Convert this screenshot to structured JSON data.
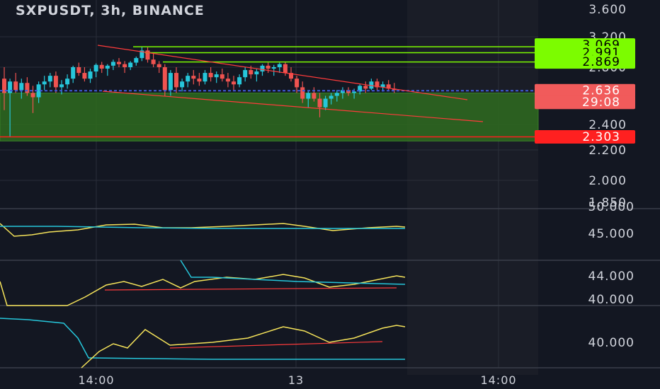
{
  "header": {
    "title": "SXPUSDT, 3h, BINANCE"
  },
  "colors": {
    "background": "#131722",
    "axis_background": "#131722",
    "price_text": "#d1d4dc",
    "bull": "#26c6da",
    "bear": "#ef5350",
    "resistance": "#7cfc00",
    "support_zone": "#2e6b1f",
    "support_line": "#ff1e1e",
    "trend": "#ff3b3b",
    "dotted_current": "#3f5bd8",
    "oscillator_a": "#f5e35a",
    "oscillator_b": "#26c6da"
  },
  "price_axis": {
    "ticks": [
      "3.600",
      "3.200",
      "2.800",
      "2.400",
      "2.200",
      "2.000",
      "1.850"
    ],
    "tick_values": [
      3.6,
      3.2,
      2.8,
      2.4,
      2.2,
      2.0,
      1.85
    ]
  },
  "price_labels": [
    {
      "text": "3.069",
      "value": 3.069,
      "kind": "resistance"
    },
    {
      "text": "2.991",
      "value": 2.991,
      "kind": "resistance"
    },
    {
      "text": "2.869",
      "value": 2.869,
      "kind": "resistance"
    },
    {
      "text": "2.636",
      "value": 2.636,
      "kind": "current"
    },
    {
      "text": "29:08",
      "value": 2.58,
      "kind": "countdown"
    },
    {
      "text": "2.303",
      "value": 2.303,
      "kind": "support"
    }
  ],
  "indicator_panes": [
    {
      "ticks": [
        "50.000",
        "45.000"
      ],
      "tick_values": [
        50,
        45
      ]
    },
    {
      "ticks": [
        "44.000",
        "40.000"
      ],
      "tick_values": [
        44,
        40
      ]
    },
    {
      "ticks": [
        "40.000"
      ],
      "tick_values": [
        40
      ]
    }
  ],
  "time_axis": {
    "ticks": [
      "14:00",
      "13",
      "14:00"
    ]
  },
  "chart_data": {
    "type": "candlestick",
    "symbol": "SXPUSDT",
    "interval": "3h",
    "exchange": "BINANCE",
    "ylim": [
      1.85,
      3.6
    ],
    "horizontal_levels": [
      3.069,
      2.991,
      2.869,
      2.636,
      2.303
    ],
    "support_zone": [
      2.27,
      2.62
    ],
    "candles": [
      [
        2.72,
        2.8,
        2.5,
        2.62
      ],
      [
        2.62,
        2.72,
        2.3,
        2.7
      ],
      [
        2.7,
        2.76,
        2.62,
        2.64
      ],
      [
        2.64,
        2.72,
        2.58,
        2.69
      ],
      [
        2.69,
        2.73,
        2.6,
        2.62
      ],
      [
        2.62,
        2.67,
        2.48,
        2.59
      ],
      [
        2.59,
        2.7,
        2.55,
        2.68
      ],
      [
        2.68,
        2.74,
        2.64,
        2.7
      ],
      [
        2.7,
        2.76,
        2.66,
        2.74
      ],
      [
        2.74,
        2.77,
        2.62,
        2.66
      ],
      [
        2.66,
        2.71,
        2.61,
        2.68
      ],
      [
        2.68,
        2.75,
        2.65,
        2.72
      ],
      [
        2.72,
        2.82,
        2.69,
        2.8
      ],
      [
        2.8,
        2.86,
        2.74,
        2.76
      ],
      [
        2.76,
        2.8,
        2.7,
        2.72
      ],
      [
        2.72,
        2.79,
        2.69,
        2.77
      ],
      [
        2.77,
        2.85,
        2.73,
        2.83
      ],
      [
        2.83,
        2.87,
        2.76,
        2.79
      ],
      [
        2.79,
        2.84,
        2.74,
        2.82
      ],
      [
        2.82,
        2.9,
        2.78,
        2.87
      ],
      [
        2.87,
        2.92,
        2.8,
        2.84
      ],
      [
        2.84,
        2.88,
        2.76,
        2.8
      ],
      [
        2.8,
        2.88,
        2.78,
        2.86
      ],
      [
        2.86,
        2.94,
        2.82,
        2.92
      ],
      [
        2.92,
        3.07,
        2.88,
        3.02
      ],
      [
        3.02,
        3.06,
        2.86,
        2.9
      ],
      [
        2.9,
        2.98,
        2.8,
        2.84
      ],
      [
        2.84,
        2.88,
        2.76,
        2.8
      ],
      [
        2.8,
        2.84,
        2.6,
        2.64
      ],
      [
        2.64,
        2.78,
        2.6,
        2.76
      ],
      [
        2.76,
        2.8,
        2.62,
        2.66
      ],
      [
        2.66,
        2.72,
        2.63,
        2.7
      ],
      [
        2.7,
        2.76,
        2.66,
        2.74
      ],
      [
        2.74,
        2.78,
        2.68,
        2.72
      ],
      [
        2.72,
        2.76,
        2.67,
        2.7
      ],
      [
        2.7,
        2.78,
        2.68,
        2.76
      ],
      [
        2.76,
        2.8,
        2.7,
        2.73
      ],
      [
        2.73,
        2.77,
        2.69,
        2.75
      ],
      [
        2.75,
        2.79,
        2.7,
        2.72
      ],
      [
        2.72,
        2.76,
        2.66,
        2.7
      ],
      [
        2.7,
        2.74,
        2.64,
        2.68
      ],
      [
        2.68,
        2.75,
        2.66,
        2.73
      ],
      [
        2.73,
        2.8,
        2.7,
        2.78
      ],
      [
        2.78,
        2.82,
        2.72,
        2.75
      ],
      [
        2.75,
        2.79,
        2.7,
        2.77
      ],
      [
        2.77,
        2.84,
        2.74,
        2.82
      ],
      [
        2.82,
        2.86,
        2.76,
        2.79
      ],
      [
        2.79,
        2.83,
        2.74,
        2.8
      ],
      [
        2.8,
        2.86,
        2.76,
        2.84
      ],
      [
        2.84,
        2.87,
        2.74,
        2.76
      ],
      [
        2.76,
        2.8,
        2.7,
        2.72
      ],
      [
        2.72,
        2.74,
        2.62,
        2.66
      ],
      [
        2.66,
        2.7,
        2.55,
        2.58
      ],
      [
        2.58,
        2.64,
        2.52,
        2.62
      ],
      [
        2.62,
        2.66,
        2.56,
        2.58
      ],
      [
        2.58,
        2.62,
        2.45,
        2.52
      ],
      [
        2.52,
        2.6,
        2.5,
        2.58
      ],
      [
        2.58,
        2.62,
        2.54,
        2.6
      ],
      [
        2.6,
        2.64,
        2.56,
        2.62
      ],
      [
        2.62,
        2.66,
        2.58,
        2.64
      ],
      [
        2.64,
        2.66,
        2.6,
        2.62
      ],
      [
        2.62,
        2.65,
        2.58,
        2.63
      ],
      [
        2.63,
        2.68,
        2.61,
        2.67
      ],
      [
        2.67,
        2.7,
        2.62,
        2.65
      ],
      [
        2.65,
        2.72,
        2.64,
        2.7
      ],
      [
        2.7,
        2.72,
        2.64,
        2.66
      ],
      [
        2.66,
        2.7,
        2.63,
        2.68
      ],
      [
        2.68,
        2.71,
        2.64,
        2.65
      ],
      [
        2.65,
        2.69,
        2.62,
        2.64
      ]
    ]
  }
}
